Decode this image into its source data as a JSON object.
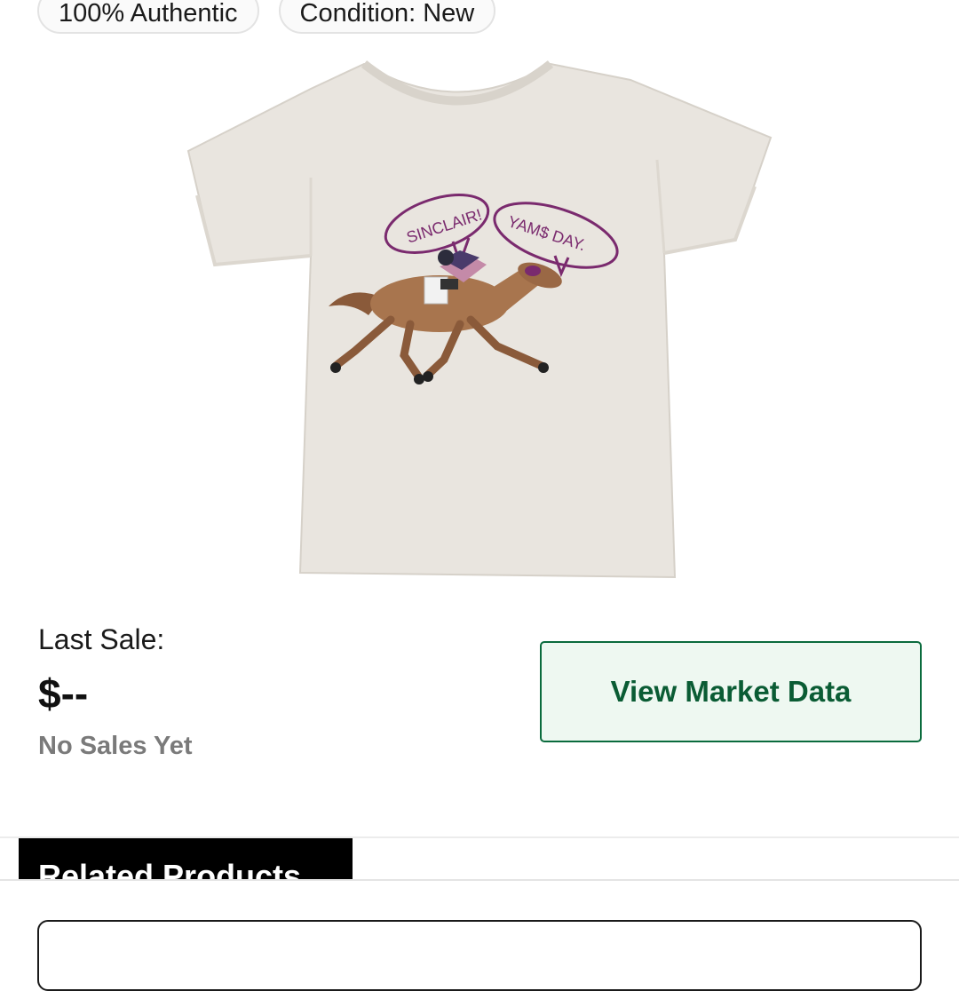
{
  "badges": {
    "authentic": "100% Authentic",
    "condition": "Condition: New"
  },
  "product": {
    "image_alt": "Cream t-shirt with racehorse and jockey illustration",
    "bubble_left": "SINCLAIR!",
    "bubble_right": "YAM$ DAY."
  },
  "sale": {
    "label": "Last Sale:",
    "price": "$--",
    "status": "No Sales Yet"
  },
  "market_button": {
    "label": "View Market Data"
  },
  "tabs": {
    "related": "Related Products"
  },
  "colors": {
    "brand_green": "#0a6b3d",
    "button_bg": "#eef8f1",
    "muted_text": "#7a7a7a"
  }
}
